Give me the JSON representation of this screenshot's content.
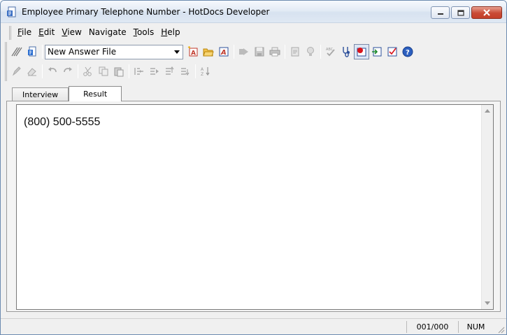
{
  "window": {
    "title": "Employee Primary Telephone Number - HotDocs Developer",
    "app_icon": "hotdocs-document-icon"
  },
  "menu": [
    {
      "accel": "F",
      "rest": "ile"
    },
    {
      "accel": "E",
      "rest": "dit"
    },
    {
      "accel": "V",
      "rest": "iew"
    },
    {
      "accel": "",
      "pre": "Navigate",
      "rest": ""
    },
    {
      "accel": "T",
      "rest": "ools"
    },
    {
      "accel": "H",
      "rest": "elp"
    }
  ],
  "toolbar": {
    "answer_file": "New Answer File"
  },
  "tabs": {
    "interview": "Interview",
    "result": "Result"
  },
  "document": {
    "text": "(800) 500-5555"
  },
  "status": {
    "page": "001/000",
    "num": "NUM"
  },
  "colors": {
    "accent": "#3a6fc4",
    "record_button": "#d9141c",
    "close_button": "#c4402a"
  }
}
